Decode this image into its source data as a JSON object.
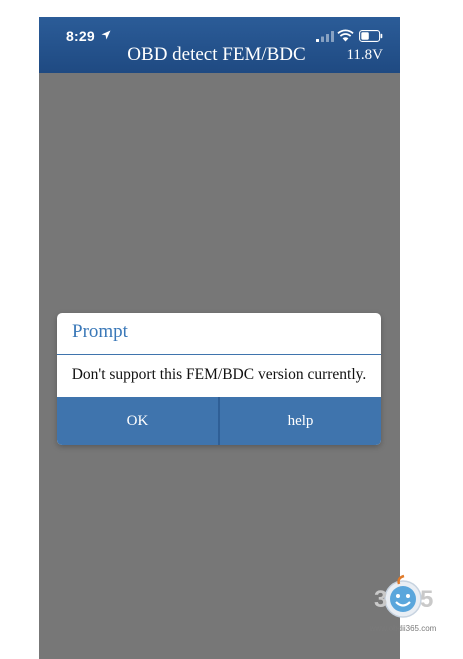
{
  "status_bar": {
    "time": "8:29",
    "icons": [
      "location-arrow-icon",
      "signal-icon",
      "wifi-icon",
      "battery-icon"
    ]
  },
  "header": {
    "title": "OBD detect FEM/BDC",
    "voltage": "11.8V",
    "background_color": "#21508a"
  },
  "dialog": {
    "title": "Prompt",
    "message": "Don't support this FEM/BDC version currently.",
    "buttons": {
      "ok": "OK",
      "help": "help"
    },
    "accent_color": "#3f74ad"
  },
  "watermark": {
    "logo_text": "365",
    "url": "www.obdii365.com"
  }
}
